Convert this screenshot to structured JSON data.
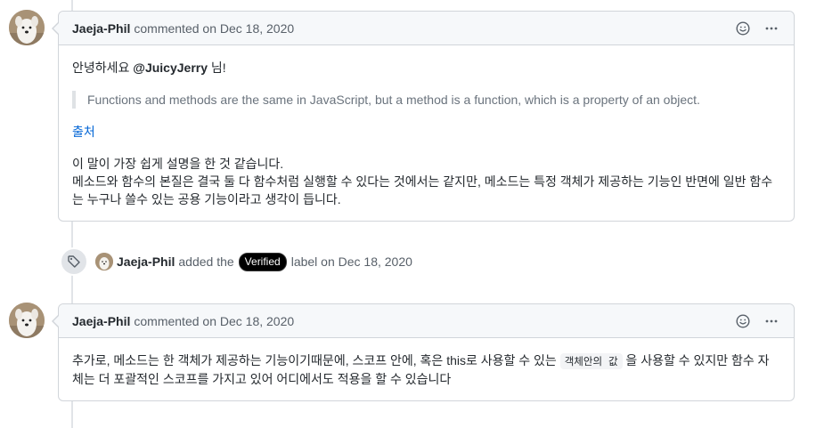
{
  "comment1": {
    "author": "Jaeja-Phil",
    "action": "commented on Dec 18, 2020",
    "greeting_prefix": "안녕하세요 ",
    "mention": "@JuicyJerry",
    "greeting_suffix": " 님!",
    "quote": "Functions and methods are the same in JavaScript, but a method is a function, which is a property of an object.",
    "source_link": "출처",
    "paragraph_line1": "이 말이 가장 쉽게 설명을 한 것 같습니다.",
    "paragraph_line2": "메소드와 함수의 본질은 결국 둘 다 함수처럼 실행할 수 있다는 것에서는 같지만, 메소드는 특정 객체가 제공하는 기능인 반면에 일반 함수는 누구나 쓸수 있는 공용 기능이라고 생각이 듭니다."
  },
  "event": {
    "author": "Jaeja-Phil",
    "added_text": "added the",
    "label": "Verified",
    "label_color": "#000000",
    "suffix": "label on Dec 18, 2020",
    "icon": "tag-icon"
  },
  "comment2": {
    "author": "Jaeja-Phil",
    "action": "commented on Dec 18, 2020",
    "text_before": "추가로, 메소드는 한 객체가 제공하는 기능이기때문에, 스코프 안에, 혹은 this로 사용할 수 있는 ",
    "code": "객체안의 값",
    "text_after": " 을 사용할 수 있지만 함수 자체는 더 포괄적인 스코프를 가지고 있어 어디에서도 적용을 할 수 있습니다"
  },
  "icons": {
    "reaction": "smiley-icon",
    "menu": "kebab-horizontal-icon"
  },
  "colors": {
    "link": "#0366d6",
    "header_bg": "#f6f8fa",
    "border": "#d1d5da"
  }
}
